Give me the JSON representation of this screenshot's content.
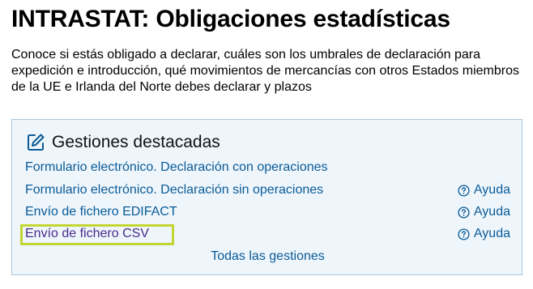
{
  "page": {
    "title": "INTRASTAT: Obligaciones estadísticas",
    "intro": "Conoce si estás obligado a declarar, cuáles son los umbrales de declaración para expedición e introducción, qué movimientos de mercancías con otros Estados miembros de la UE e Irlanda del Norte debes declarar y plazos"
  },
  "panel": {
    "title": "Gestiones destacadas",
    "icon": "edit-icon",
    "items": [
      {
        "label": "Formulario electrónico. Declaración con operaciones",
        "help": ""
      },
      {
        "label": "Formulario electrónico. Declaración sin operaciones",
        "help": "Ayuda"
      },
      {
        "label": "Envío de fichero EDIFACT",
        "help": "Ayuda"
      },
      {
        "label": "Envío de fichero CSV",
        "help": "Ayuda"
      }
    ],
    "all_link": "Todas las gestiones",
    "colors": {
      "link": "#0a5a96",
      "panel_background": "#eef6fc",
      "highlight": "#c3d531"
    }
  }
}
